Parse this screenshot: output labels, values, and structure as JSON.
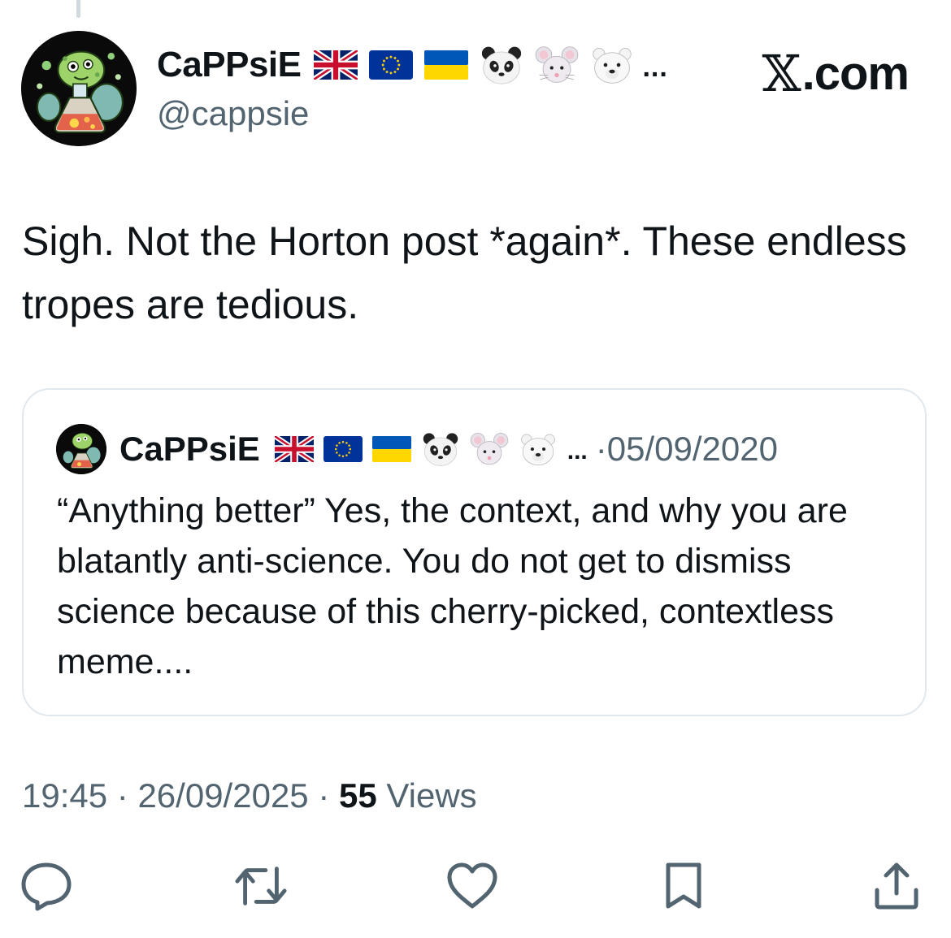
{
  "header": {
    "display_name": "CaPPsiE",
    "handle": "@cappsie",
    "name_ellipsis": "...",
    "brand_mark": "𝕏",
    "brand_text": ".com",
    "badges": [
      "uk-flag-icon",
      "eu-flag-icon",
      "ukraine-flag-icon",
      "panda-face-icon",
      "mouse-face-icon",
      "polar-bear-face-icon"
    ]
  },
  "post": {
    "text": "Sigh. Not the Horton post *again*. These endless tropes are tedious."
  },
  "quote": {
    "display_name": "CaPPsiE",
    "name_ellipsis": "...",
    "separator": "·",
    "date": "05/09/2020",
    "text": "“Anything better” Yes, the context, and why you are blatantly anti-science. You do not get to dismiss science because of this cherry-picked, contextless meme...."
  },
  "meta": {
    "time": "19:45",
    "separator": "·",
    "date": "26/09/2025",
    "views_count": "55",
    "views_label": "Views"
  },
  "actions": [
    "reply-icon",
    "retweet-icon",
    "like-icon",
    "bookmark-icon",
    "share-icon"
  ],
  "colors": {
    "text": "#0f1419",
    "secondary": "#536471",
    "border": "#e1e8ed"
  }
}
